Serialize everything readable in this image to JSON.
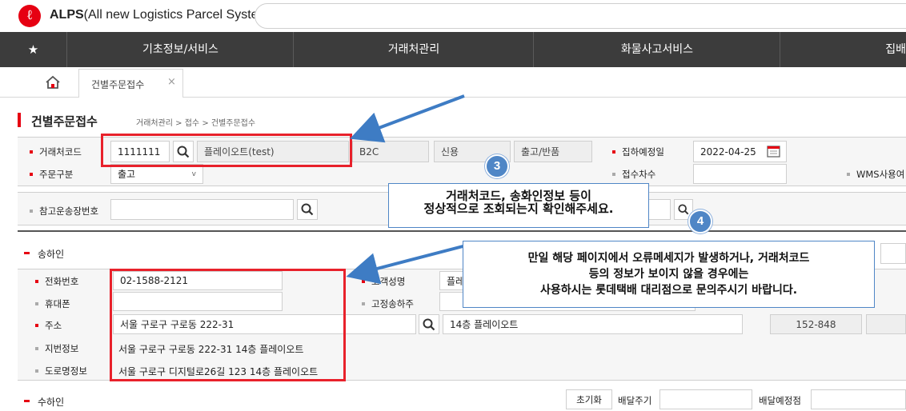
{
  "app": {
    "logo_letter": "ℓ",
    "brand": "ALPS",
    "brand_full_prefix": "(",
    "brand_full": "All new Logistics Parcel System)"
  },
  "menu": {
    "star": "★",
    "items": [
      "기초정보/서비스",
      "거래처관리",
      "화물사고서비스",
      "집배"
    ]
  },
  "tabs": [
    {
      "label": "건별주문접수",
      "close": "×"
    }
  ],
  "page": {
    "title": "건별주문접수",
    "breadcrumb": "거래처관리 > 접수 > 건별주문접수"
  },
  "order": {
    "client_code_label": "거래처코드",
    "client_code": "1111111",
    "client_name": "플레이오트(test)",
    "biz_type": "B2C",
    "pay_type": "신용",
    "ship_type": "출고/반품",
    "pickup_date_label": "집하예정일",
    "pickup_date": "2022-04-25",
    "order_type_label": "주문구분",
    "order_type": "출고",
    "order_type_caret": "v",
    "receipt_seq_label": "접수차수",
    "wms_label": "WMS사용여",
    "ref_waybill_label": "참고운송장번호"
  },
  "sender": {
    "section_label": "송하인",
    "phone_label": "전화번호",
    "phone": "02-1588-2121",
    "mobile_label": "휴대폰",
    "address_label": "주소",
    "address": "서울 구로구 구로동 222-31",
    "address_detail": "14층 플레이오트",
    "zip": "152-848",
    "jibun_label": "지번정보",
    "jibun": "서울 구로구 구로동  222-31 14층 플레이오트",
    "road_label": "도로명정보",
    "road": "서울 구로구 디지털로26길 123 14층 플레이오트",
    "customer_name_label": "고객성명",
    "customer_name_partial": "플레",
    "fixed_sender_label": "고정송하주"
  },
  "receiver": {
    "section_label": "수하인",
    "reset_label": "초기화",
    "delivery_cycle_label": "배달주기",
    "delivery_point_label": "배달예정점"
  },
  "annotations": {
    "callout3_line1": "거래처코드, 송화인정보 등이",
    "callout3_line2": "정상적으로 조회되는지 확인해주세요.",
    "badge3": "3",
    "callout4_line1": "만일 해당 페이지에서 오류메세지가 발생하거나, 거래처코드",
    "callout4_line2": "등의 정보가 보이지 않을 경우에는",
    "callout4_line3": "사용하시는 롯데택배 대리점으로 문의주시기 바랍니다.",
    "badge4": "4"
  },
  "colors": {
    "brand_red": "#e60012",
    "menu_bg": "#3c3c3c",
    "callout_blue": "#4f86c6",
    "highlight_red": "#e8212b"
  }
}
